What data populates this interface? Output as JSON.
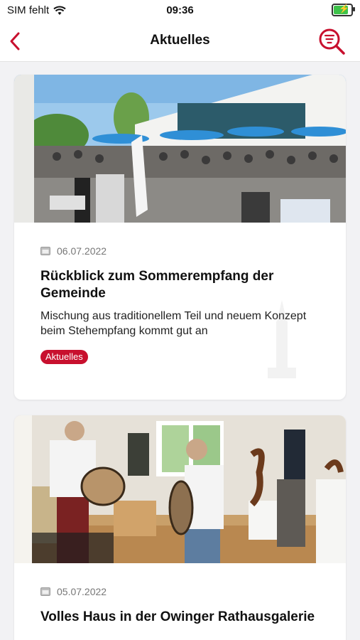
{
  "status_bar": {
    "carrier": "SIM fehlt",
    "time": "09:36",
    "battery_percent": 90
  },
  "nav": {
    "title": "Aktuelles",
    "back_icon": "chevron-left-icon",
    "search_icon": "search-filter-icon"
  },
  "colors": {
    "accent": "#c8102e"
  },
  "articles": [
    {
      "date": "06.07.2022",
      "title": "Rückblick zum Sommerempfang der Gemeinde",
      "summary": "Mischung aus traditionellem Teil und neuem Konzept beim Stehempfang kommt gut an",
      "tag": "Aktuelles"
    },
    {
      "date": "05.07.2022",
      "title": "Volles Haus in der Owinger Rathausgalerie"
    }
  ]
}
